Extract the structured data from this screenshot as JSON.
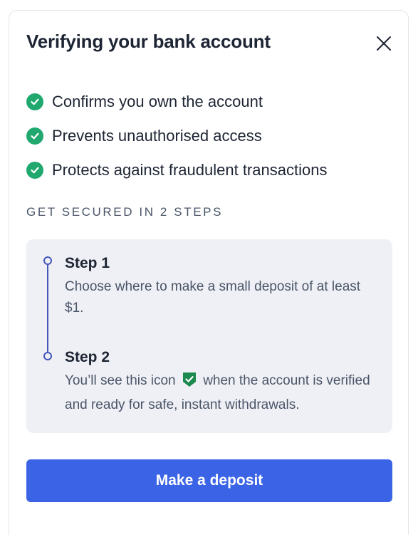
{
  "modal": {
    "title": "Verifying your bank account",
    "close_icon": "close-icon"
  },
  "benefits": [
    {
      "icon": "check-circle-icon",
      "text": "Confirms you own the account"
    },
    {
      "icon": "check-circle-icon",
      "text": "Prevents unauthorised access"
    },
    {
      "icon": "check-circle-icon",
      "text": "Protects against fraudulent transactions"
    }
  ],
  "steps_section": {
    "heading": "GET SECURED IN 2 STEPS",
    "steps": [
      {
        "title": "Step 1",
        "description": "Choose where to make a small deposit of at least $1."
      },
      {
        "title": "Step 2",
        "description_before_icon": "You’ll see this icon",
        "inline_icon": "verified-shield-icon",
        "description_after_icon": "when the account is verified and ready for safe, instant withdrawals."
      }
    ]
  },
  "cta": {
    "label": "Make a deposit"
  },
  "colors": {
    "check_green": "#20a86f",
    "accent_blue": "#3b63e6",
    "timeline_blue": "#4457b8",
    "steps_bg": "#eff0f5",
    "shield_green": "#1a8a4e"
  }
}
